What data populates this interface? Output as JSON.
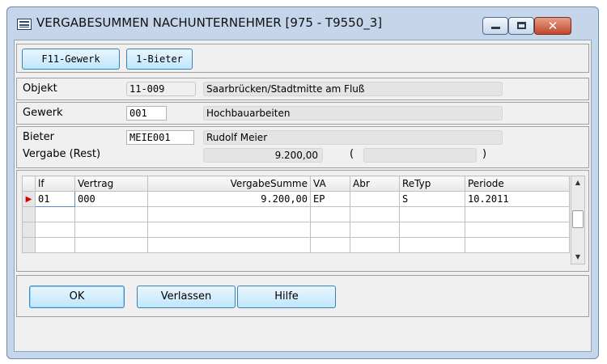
{
  "window": {
    "title": "VERGABESUMMEN NACHUNTERNEHMER  [975 - T9550_3]",
    "close_glyph": "✕"
  },
  "toolbar": {
    "gewerk_button": "F11-Gewerk",
    "bieter_button": "1-Bieter"
  },
  "objekt": {
    "label": "Objekt",
    "code": "11-009",
    "name": "Saarbrücken/Stadtmitte am Fluß"
  },
  "gewerk": {
    "label": "Gewerk",
    "code": "001",
    "name": "Hochbauarbeiten"
  },
  "bieter": {
    "label": "Bieter",
    "code": "MEIE001",
    "name": "Rudolf Meier",
    "vergabe_label": "Vergabe (Rest)",
    "vergabe_value": "9.200,00",
    "paren_open": "(",
    "paren_close": ")",
    "paren_value": ""
  },
  "grid": {
    "columns": [
      "lf",
      "Vertrag",
      "VergabeSumme",
      "VA",
      "Abr",
      "ReTyp",
      "Periode"
    ],
    "rows": [
      {
        "lf": "01",
        "vertrag": "000",
        "vergabesumme": "9.200,00",
        "va": "EP",
        "abr": "",
        "retyp": "S",
        "periode": "10.2011"
      }
    ],
    "row_marker": "▶",
    "scroll_up": "▲",
    "scroll_down": "▼"
  },
  "footer": {
    "ok": "OK",
    "verlassen": "Verlassen",
    "hilfe": "Hilfe"
  },
  "colors": {
    "title_bg": "#c5d6ea",
    "button_border": "#3c7fb1",
    "row_marker": "#d40000"
  }
}
